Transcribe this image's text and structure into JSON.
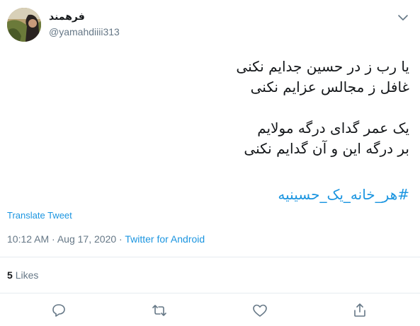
{
  "author": {
    "display_name": "فرهمند",
    "handle": "@yamahdiiii313"
  },
  "tweet": {
    "text": "یا رب ز در حسین جدایم نکنی\nغافل ز مجالس عزایم نکنی\n\nیک عمر گدای درگه مولایم\nبر درگه این و آن گدایم نکنی",
    "hashtag": "#هر_خانه_یک_حسینیه",
    "translate_label": "Translate Tweet",
    "time": "10:12 AM",
    "date": "Aug 17, 2020",
    "separator": "·",
    "source": "Twitter for Android"
  },
  "stats": {
    "likes_count": "5",
    "likes_label": "Likes"
  },
  "icons": {
    "caret": "chevron-down-icon",
    "reply": "reply-icon",
    "retweet": "retweet-icon",
    "like": "heart-icon",
    "share": "share-icon"
  },
  "colors": {
    "link": "#1b95e0",
    "secondary": "#657786",
    "text": "#14171a",
    "divider": "#e6ecf0"
  }
}
